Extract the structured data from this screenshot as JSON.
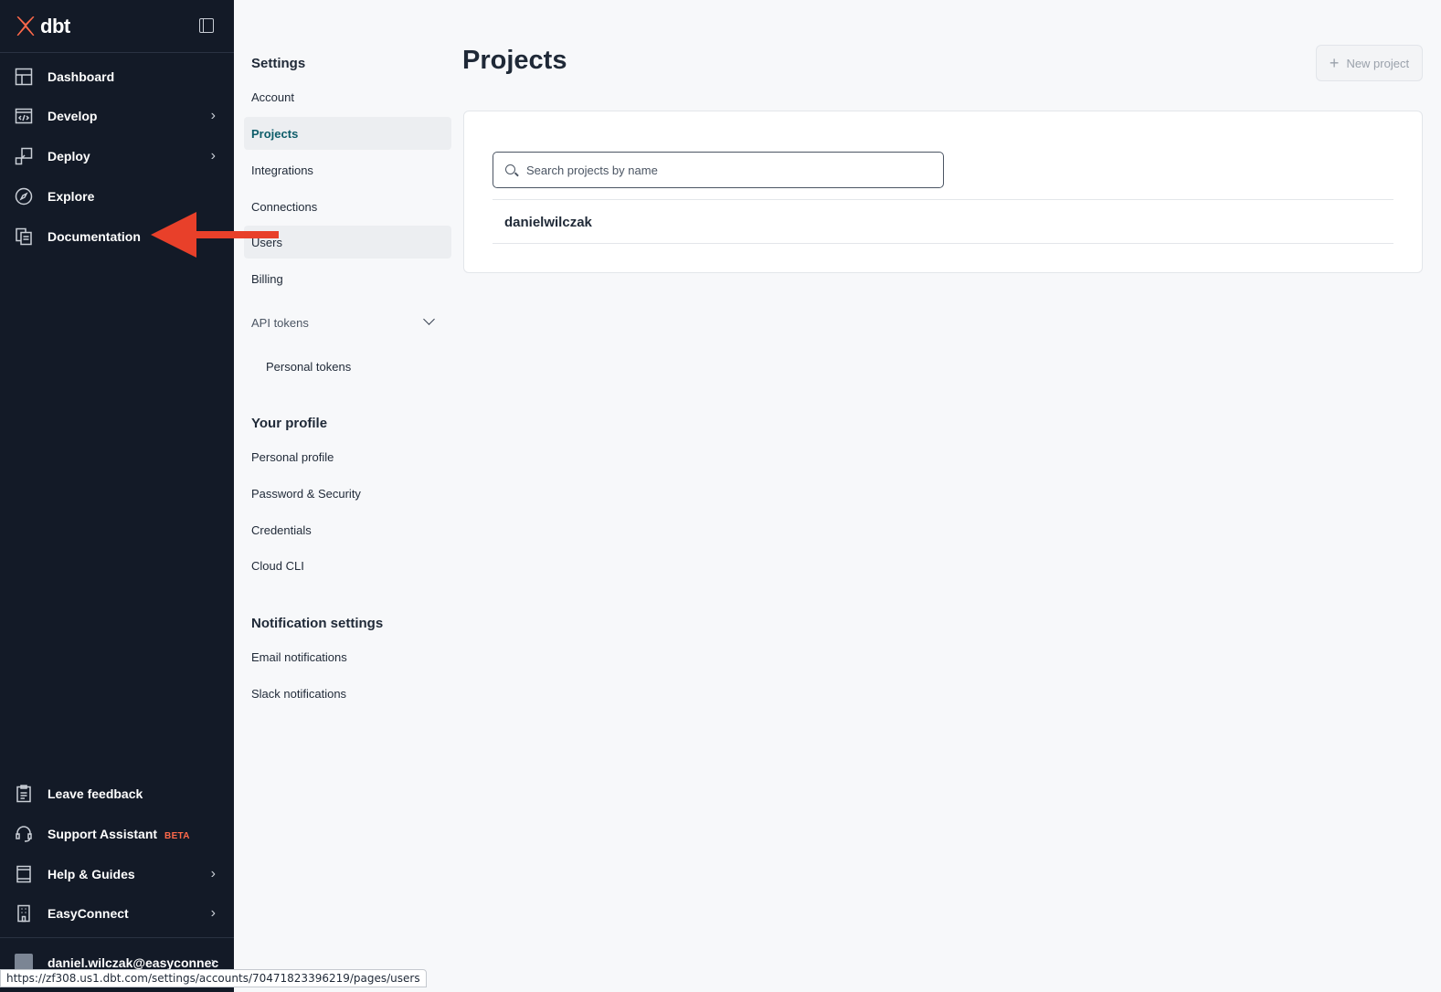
{
  "nav": {
    "logo": "dbt",
    "items": [
      {
        "label": "Dashboard",
        "icon": "dashboard-icon",
        "chevron": false
      },
      {
        "label": "Develop",
        "icon": "code-icon",
        "chevron": true
      },
      {
        "label": "Deploy",
        "icon": "deploy-icon",
        "chevron": true
      },
      {
        "label": "Explore",
        "icon": "compass-icon",
        "chevron": false
      },
      {
        "label": "Documentation",
        "icon": "documents-icon",
        "chevron": false
      }
    ],
    "bottom": [
      {
        "label": "Leave feedback",
        "icon": "clipboard-icon"
      },
      {
        "label": "Support Assistant",
        "badge": "BETA",
        "icon": "headset-icon"
      },
      {
        "label": "Help & Guides",
        "icon": "book-icon"
      },
      {
        "label": "EasyConnect",
        "icon": "building-icon"
      },
      {
        "label": "daniel.wilczak@easyconnec",
        "icon": "avatar"
      }
    ]
  },
  "settings": {
    "title": "Settings",
    "items": [
      "Account",
      "Projects",
      "Integrations",
      "Connections",
      "Users",
      "Billing"
    ],
    "api_tokens": "API tokens",
    "personal_tokens": "Personal tokens",
    "profile_title": "Your profile",
    "profile_items": [
      "Personal profile",
      "Password & Security",
      "Credentials",
      "Cloud CLI"
    ],
    "notif_title": "Notification settings",
    "notif_items": [
      "Email notifications",
      "Slack notifications"
    ]
  },
  "main": {
    "title": "Projects",
    "new_project": "New project",
    "search_placeholder": "Search projects by name",
    "projects": [
      "danielwilczak"
    ]
  },
  "status_url": "https://zf308.us1.dbt.com/settings/accounts/70471823396219/pages/users",
  "colors": {
    "nav_bg": "#131a27",
    "accent": "#ff694a",
    "active_text": "#0e5d6a",
    "arrow": "#e8402a"
  }
}
